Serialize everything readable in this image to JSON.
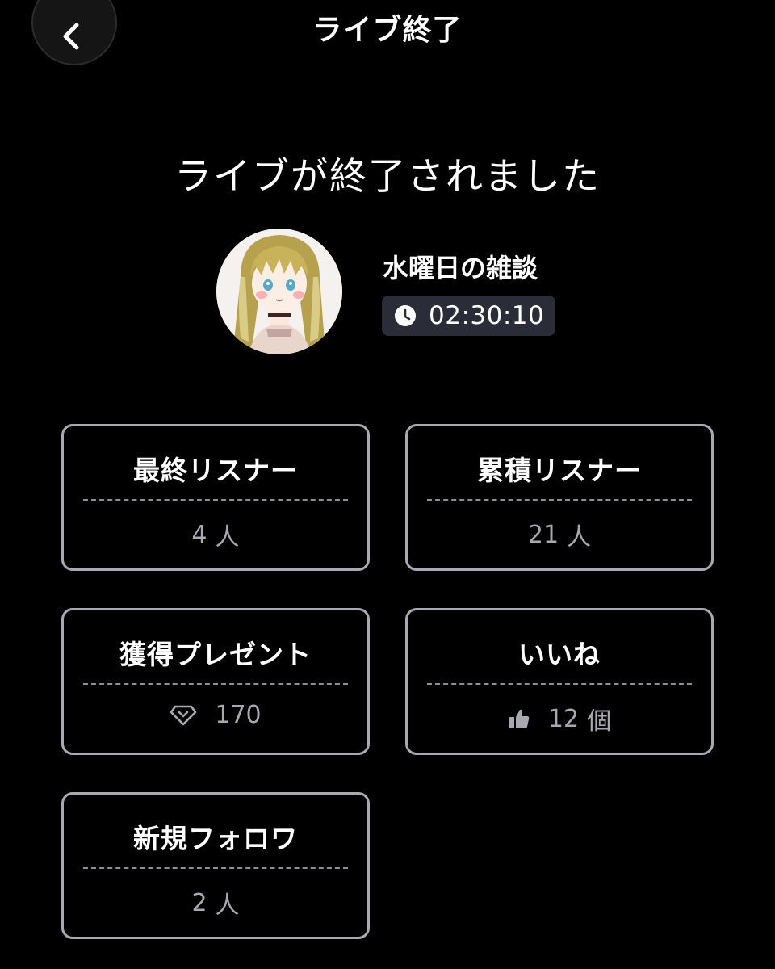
{
  "header": {
    "title": "ライブ終了",
    "back_icon": "chevron-left-icon"
  },
  "message": "ライブが終了されました",
  "stream": {
    "title": "水曜日の雑談",
    "duration": "02:30:10",
    "duration_icon": "clock-icon"
  },
  "stats": {
    "final_listeners": {
      "label": "最終リスナー",
      "value": "4",
      "unit": "人"
    },
    "total_listeners": {
      "label": "累積リスナー",
      "value": "21",
      "unit": "人"
    },
    "gifts": {
      "label": "獲得プレゼント",
      "value": "170",
      "icon": "diamond-icon"
    },
    "likes": {
      "label": "いいね",
      "value": "12",
      "unit": "個",
      "icon": "thumbs-up-icon"
    },
    "new_followers": {
      "label": "新規フォロワ",
      "value": "2",
      "unit": "人"
    }
  },
  "colors": {
    "background": "#000000",
    "card_border": "#a9a9b3",
    "badge_bg": "#2a2d38",
    "value_text": "#a8a8b0"
  }
}
